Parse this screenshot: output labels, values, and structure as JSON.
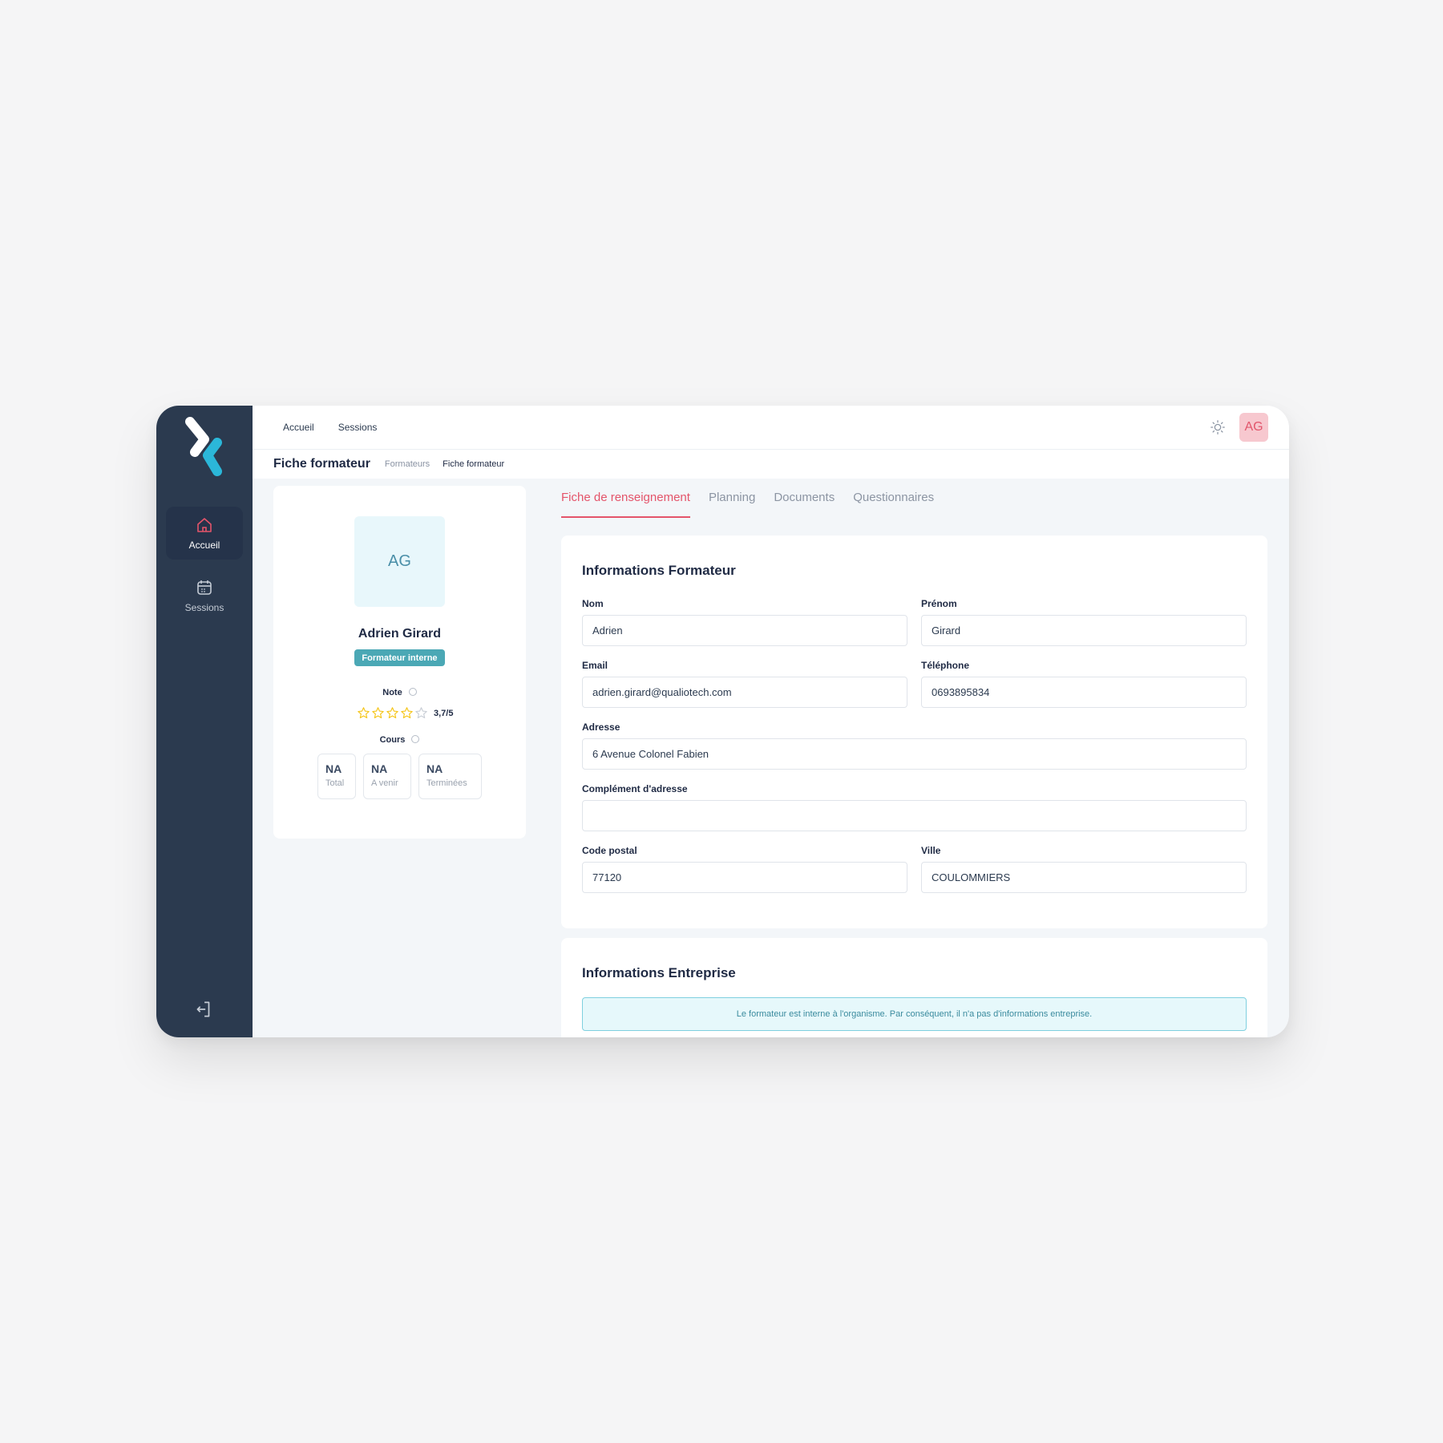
{
  "sidebar": {
    "items": [
      {
        "label": "Accueil",
        "icon": "home-icon"
      },
      {
        "label": "Sessions",
        "icon": "calendar-icon"
      }
    ],
    "logout_icon": "logout-icon"
  },
  "topbar": {
    "links": [
      "Accueil",
      "Sessions"
    ],
    "theme_icon": "sun-icon",
    "avatar": "AG"
  },
  "header": {
    "title": "Fiche formateur",
    "breadcrumb": [
      "Formateurs",
      "Fiche formateur"
    ]
  },
  "profile": {
    "initials": "AG",
    "name": "Adrien Girard",
    "badge": "Formateur interne",
    "note_label": "Note",
    "rating": 3.7,
    "rating_text": "3,7/5",
    "rating_max": 5,
    "cours_label": "Cours",
    "stats": [
      {
        "value": "NA",
        "label": "Total"
      },
      {
        "value": "NA",
        "label": "A venir"
      },
      {
        "value": "NA",
        "label": "Terminées"
      }
    ]
  },
  "tabs": [
    {
      "label": "Fiche de renseignement",
      "active": true
    },
    {
      "label": "Planning",
      "active": false
    },
    {
      "label": "Documents",
      "active": false
    },
    {
      "label": "Questionnaires",
      "active": false
    }
  ],
  "formateur": {
    "title": "Informations Formateur",
    "fields": {
      "nom": {
        "label": "Nom",
        "value": "Adrien"
      },
      "prenom": {
        "label": "Prénom",
        "value": "Girard"
      },
      "email": {
        "label": "Email",
        "value": "adrien.girard@qualiotech.com"
      },
      "telephone": {
        "label": "Téléphone",
        "value": "0693895834"
      },
      "adresse": {
        "label": "Adresse",
        "value": "6 Avenue Colonel Fabien"
      },
      "complement": {
        "label": "Complément d'adresse",
        "value": ""
      },
      "code_postal": {
        "label": "Code postal",
        "value": "77120"
      },
      "ville": {
        "label": "Ville",
        "value": "COULOMMIERS"
      }
    }
  },
  "entreprise": {
    "title": "Informations Entreprise",
    "notice": "Le formateur est interne à l'organisme. Par conséquent, il n'a pas d'informations entreprise."
  },
  "colors": {
    "sidebar": "#2b3a4f",
    "accent": "#e4546a",
    "badge": "#4ba8b5",
    "star": "#f5c518"
  }
}
